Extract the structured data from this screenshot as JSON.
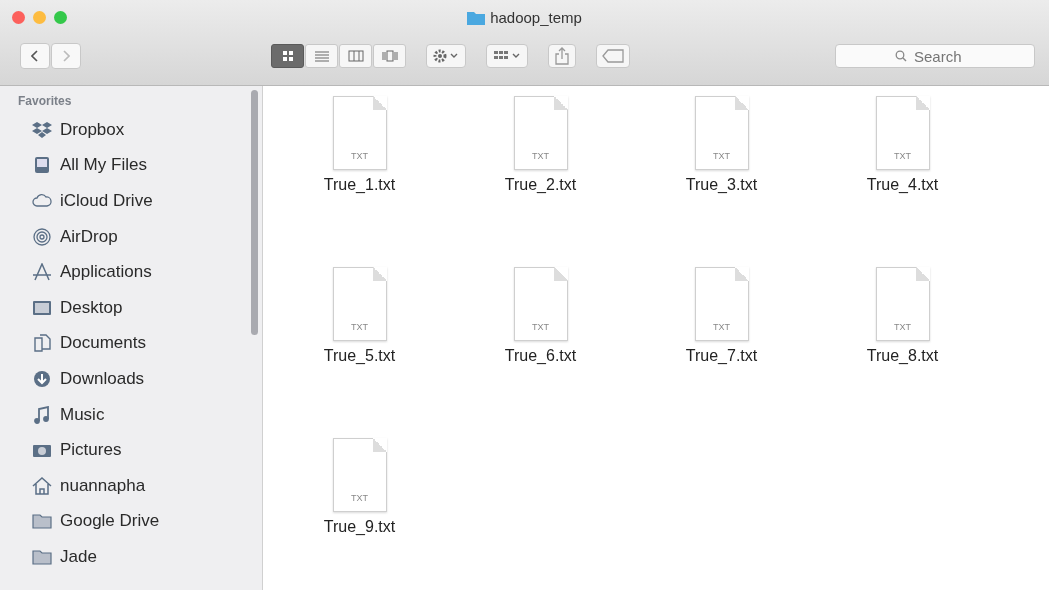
{
  "window": {
    "title": "hadoop_temp"
  },
  "toolbar": {
    "view_modes": [
      {
        "selected": true
      },
      {
        "selected": false
      },
      {
        "selected": false
      },
      {
        "selected": false
      }
    ],
    "search": {
      "placeholder": "Search"
    }
  },
  "sidebar": {
    "heading": "Favorites",
    "items": [
      {
        "label": "Dropbox"
      },
      {
        "label": "All My Files"
      },
      {
        "label": "iCloud Drive"
      },
      {
        "label": "AirDrop"
      },
      {
        "label": "Applications"
      },
      {
        "label": "Desktop"
      },
      {
        "label": "Documents"
      },
      {
        "label": "Downloads"
      },
      {
        "label": "Music"
      },
      {
        "label": "Pictures"
      },
      {
        "label": "nuannapha"
      },
      {
        "label": "Google Drive"
      },
      {
        "label": "Jade"
      }
    ]
  },
  "files": [
    {
      "name": "True_1.txt",
      "type_label": "TXT"
    },
    {
      "name": "True_2.txt",
      "type_label": "TXT"
    },
    {
      "name": "True_3.txt",
      "type_label": "TXT"
    },
    {
      "name": "True_4.txt",
      "type_label": "TXT"
    },
    {
      "name": "True_5.txt",
      "type_label": "TXT"
    },
    {
      "name": "True_6.txt",
      "type_label": "TXT"
    },
    {
      "name": "True_7.txt",
      "type_label": "TXT"
    },
    {
      "name": "True_8.txt",
      "type_label": "TXT"
    },
    {
      "name": "True_9.txt",
      "type_label": "TXT"
    }
  ]
}
